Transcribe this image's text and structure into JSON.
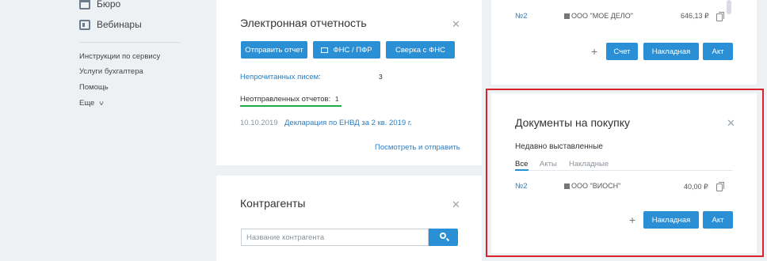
{
  "sidebar": {
    "nav": [
      {
        "label": "Бюро",
        "icon": "briefcase-icon"
      },
      {
        "label": "Вебинары",
        "icon": "film-icon"
      }
    ],
    "links": [
      "Инструкции по сервису",
      "Услуги бухгалтера",
      "Помощь"
    ],
    "more": "Еще"
  },
  "ereport": {
    "title": "Электронная отчетность",
    "buttons": [
      "Отправить отчет",
      "ФНС / ПФР",
      "Сверка с ФНС"
    ],
    "unread_label": "Непрочитанных писем:",
    "unread_count": "3",
    "unsent_label": "Неотправленных отчетов:",
    "unsent_count": "1",
    "entry_date": "10.10.2019",
    "entry_title": "Декларация по ЕНВД за 2 кв. 2019 г.",
    "view_send": "Посмотреть и отправить"
  },
  "counterparties": {
    "title": "Контрагенты",
    "search_placeholder": "Название контрагента"
  },
  "sales_docs": {
    "number": "№2",
    "org": "ООО \"МОЕ ДЕЛО\"",
    "amount": "646,13 ₽",
    "buttons": [
      "Счет",
      "Накладная",
      "Акт"
    ]
  },
  "purchase_docs": {
    "title": "Документы на покупку",
    "subtitle": "Недавно выставленные",
    "tabs": [
      "Все",
      "Акты",
      "Накладные"
    ],
    "number": "№2",
    "org": "ООО \"ВИОСН\"",
    "amount": "40,00 ₽",
    "buttons": [
      "Накладная",
      "Акт"
    ]
  },
  "colors": {
    "accent": "#2b8fd6",
    "highlight": "#d9222a",
    "link": "#2b7cc2"
  }
}
